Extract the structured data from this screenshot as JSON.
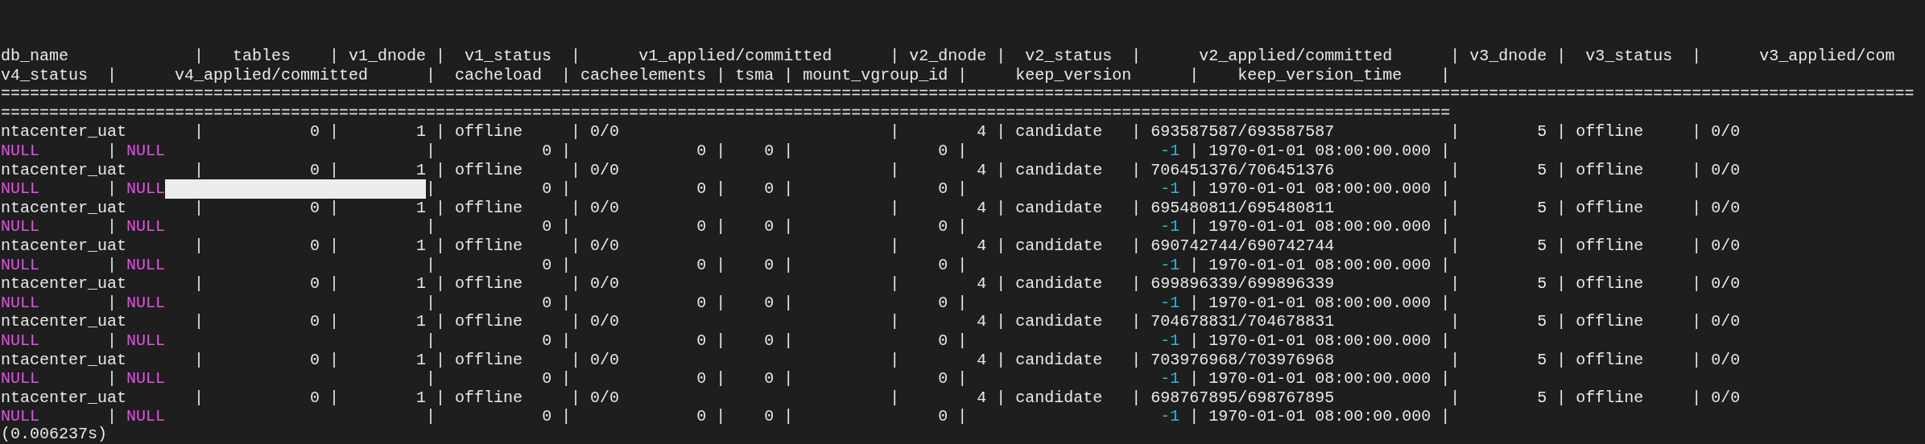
{
  "terminal": {
    "lines": [
      {
        "kind": "header",
        "segments": [
          {
            "text": "db_name             |   tables    | v1_dnode |  v1_status  |      v1_applied/committed      | v2_dnode |  v2_status  |      v2_applied/committed      | v3_dnode |  v3_status  |      v3_applied/com",
            "kind": "text"
          }
        ]
      },
      {
        "kind": "header",
        "segments": [
          {
            "text": "v4_status  |      v4_applied/committed      |  cacheload  | cacheelements | tsma | mount_vgroup_id |     keep_version      |    keep_version_time    |",
            "kind": "text"
          }
        ]
      },
      {
        "kind": "separator",
        "segments": [
          {
            "text": "======================================================================================================================================================================================================",
            "kind": "text"
          }
        ]
      },
      {
        "kind": "separator",
        "segments": [
          {
            "text": "======================================================================================================================================================",
            "kind": "text"
          }
        ]
      },
      {
        "kind": "row",
        "segments": [
          {
            "text": "ntacenter_uat       |           0 |        1 | offline     | 0/0                            |        4 | candidate   | 693587587/693587587            |        5 | offline     | 0/0",
            "kind": "text"
          }
        ]
      },
      {
        "kind": "row",
        "segments": [
          {
            "text": "NULL",
            "kind": "null"
          },
          {
            "text": "       | ",
            "kind": "text"
          },
          {
            "text": "NULL",
            "kind": "null"
          },
          {
            "text": "                           |           0 |             0 |    0 |               0 |                    ",
            "kind": "text"
          },
          {
            "text": "-1",
            "kind": "negative"
          },
          {
            "text": " | 1970-01-01 08:00:00.000 |",
            "kind": "text"
          }
        ]
      },
      {
        "kind": "row",
        "segments": [
          {
            "text": "ntacenter_uat       |           0 |        1 | offline     | 0/0                            |        4 | candidate   | 706451376/706451376            |        5 | offline     | 0/0",
            "kind": "text"
          }
        ]
      },
      {
        "kind": "row",
        "segments": [
          {
            "text": "NULL",
            "kind": "null"
          },
          {
            "text": "       | ",
            "kind": "text"
          },
          {
            "text": "NULL",
            "kind": "null"
          },
          {
            "kind": "redaction"
          },
          {
            "text": "|           0 |             0 |    0 |               0 |                    ",
            "kind": "text"
          },
          {
            "text": "-1",
            "kind": "negative"
          },
          {
            "text": " | 1970-01-01 08:00:00.000 |",
            "kind": "text"
          }
        ]
      },
      {
        "kind": "row",
        "segments": [
          {
            "text": "ntacenter_uat       |           0 |        1 | offline     | 0/0                            |        4 | candidate   | 695480811/695480811            |        5 | offline     | 0/0",
            "kind": "text"
          }
        ]
      },
      {
        "kind": "row",
        "segments": [
          {
            "text": "NULL",
            "kind": "null"
          },
          {
            "text": "       | ",
            "kind": "text"
          },
          {
            "text": "NULL",
            "kind": "null"
          },
          {
            "text": "                           |           0 |             0 |    0 |               0 |                    ",
            "kind": "text"
          },
          {
            "text": "-1",
            "kind": "negative"
          },
          {
            "text": " | 1970-01-01 08:00:00.000 |",
            "kind": "text"
          }
        ]
      },
      {
        "kind": "row",
        "segments": [
          {
            "text": "ntacenter_uat       |           0 |        1 | offline     | 0/0                            |        4 | candidate   | 690742744/690742744            |        5 | offline     | 0/0",
            "kind": "text"
          }
        ]
      },
      {
        "kind": "row",
        "segments": [
          {
            "text": "NULL",
            "kind": "null"
          },
          {
            "text": "       | ",
            "kind": "text"
          },
          {
            "text": "NULL",
            "kind": "null"
          },
          {
            "text": "                           |           0 |             0 |    0 |               0 |                    ",
            "kind": "text"
          },
          {
            "text": "-1",
            "kind": "negative"
          },
          {
            "text": " | 1970-01-01 08:00:00.000 |",
            "kind": "text"
          }
        ]
      },
      {
        "kind": "row",
        "segments": [
          {
            "text": "ntacenter_uat       |           0 |        1 | offline     | 0/0                            |        4 | candidate   | 699896339/699896339            |        5 | offline     | 0/0",
            "kind": "text"
          }
        ]
      },
      {
        "kind": "row",
        "segments": [
          {
            "text": "NULL",
            "kind": "null"
          },
          {
            "text": "       | ",
            "kind": "text"
          },
          {
            "text": "NULL",
            "kind": "null"
          },
          {
            "text": "                           |           0 |             0 |    0 |               0 |                    ",
            "kind": "text"
          },
          {
            "text": "-1",
            "kind": "negative"
          },
          {
            "text": " | 1970-01-01 08:00:00.000 |",
            "kind": "text"
          }
        ]
      },
      {
        "kind": "row",
        "segments": [
          {
            "text": "ntacenter_uat       |           0 |        1 | offline     | 0/0                            |        4 | candidate   | 704678831/704678831            |        5 | offline     | 0/0",
            "kind": "text"
          }
        ]
      },
      {
        "kind": "row",
        "segments": [
          {
            "text": "NULL",
            "kind": "null"
          },
          {
            "text": "       | ",
            "kind": "text"
          },
          {
            "text": "NULL",
            "kind": "null"
          },
          {
            "text": "                           |           0 |             0 |    0 |               0 |                    ",
            "kind": "text"
          },
          {
            "text": "-1",
            "kind": "negative"
          },
          {
            "text": " | 1970-01-01 08:00:00.000 |",
            "kind": "text"
          }
        ]
      },
      {
        "kind": "row",
        "segments": [
          {
            "text": "ntacenter_uat       |           0 |        1 | offline     | 0/0                            |        4 | candidate   | 703976968/703976968            |        5 | offline     | 0/0",
            "kind": "text"
          }
        ]
      },
      {
        "kind": "row",
        "segments": [
          {
            "text": "NULL",
            "kind": "null"
          },
          {
            "text": "       | ",
            "kind": "text"
          },
          {
            "text": "NULL",
            "kind": "null"
          },
          {
            "text": "                           |           0 |             0 |    0 |               0 |                    ",
            "kind": "text"
          },
          {
            "text": "-1",
            "kind": "negative"
          },
          {
            "text": " | 1970-01-01 08:00:00.000 |",
            "kind": "text"
          }
        ]
      },
      {
        "kind": "row",
        "segments": [
          {
            "text": "ntacenter_uat       |           0 |        1 | offline     | 0/0                            |        4 | candidate   | 698767895/698767895            |        5 | offline     | 0/0",
            "kind": "text"
          }
        ]
      },
      {
        "kind": "row",
        "segments": [
          {
            "text": "NULL",
            "kind": "null"
          },
          {
            "text": "       | ",
            "kind": "text"
          },
          {
            "text": "NULL",
            "kind": "null"
          },
          {
            "text": "                           |           0 |             0 |    0 |               0 |                    ",
            "kind": "text"
          },
          {
            "text": "-1",
            "kind": "negative"
          },
          {
            "text": " | 1970-01-01 08:00:00.000 |",
            "kind": "text"
          }
        ]
      },
      {
        "kind": "status",
        "segments": [
          {
            "text": "(0.006237s)",
            "kind": "text"
          }
        ]
      }
    ]
  }
}
